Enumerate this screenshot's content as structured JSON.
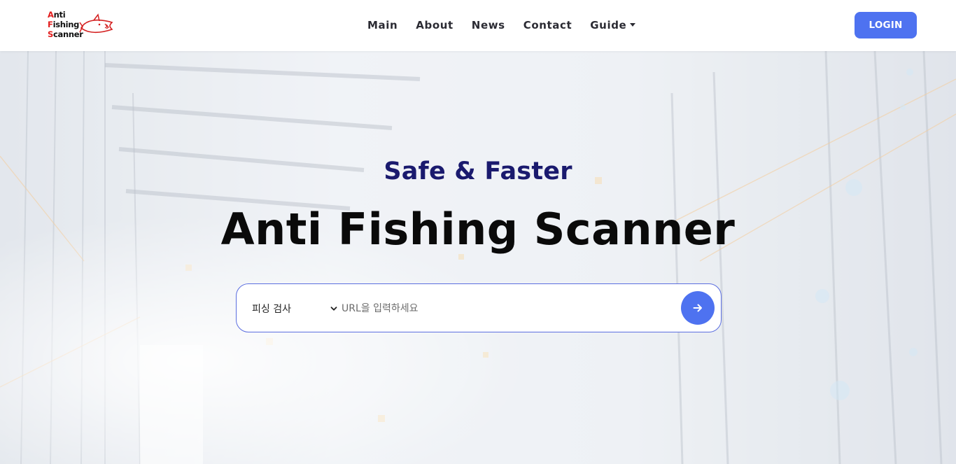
{
  "brand": {
    "logo_lines": [
      {
        "cap": "A",
        "rest": "nti"
      },
      {
        "cap": "F",
        "rest": "ishing"
      },
      {
        "cap": "S",
        "rest": "canner"
      }
    ]
  },
  "nav": {
    "items": [
      {
        "label": "Main"
      },
      {
        "label": "About"
      },
      {
        "label": "News"
      },
      {
        "label": "Contact"
      },
      {
        "label": "Guide"
      }
    ],
    "login_label": "LOGIN"
  },
  "hero": {
    "subtitle": "Safe & Faster",
    "title": "Anti Fishing Scanner"
  },
  "search": {
    "select_value": "피싱 검사",
    "placeholder": "URL을 입력하세요",
    "value": "",
    "submit_icon": "arrow-right-icon"
  },
  "colors": {
    "accent": "#4e72f0",
    "subtitle": "#1a1a6e",
    "logo_red": "#e21c1c"
  }
}
